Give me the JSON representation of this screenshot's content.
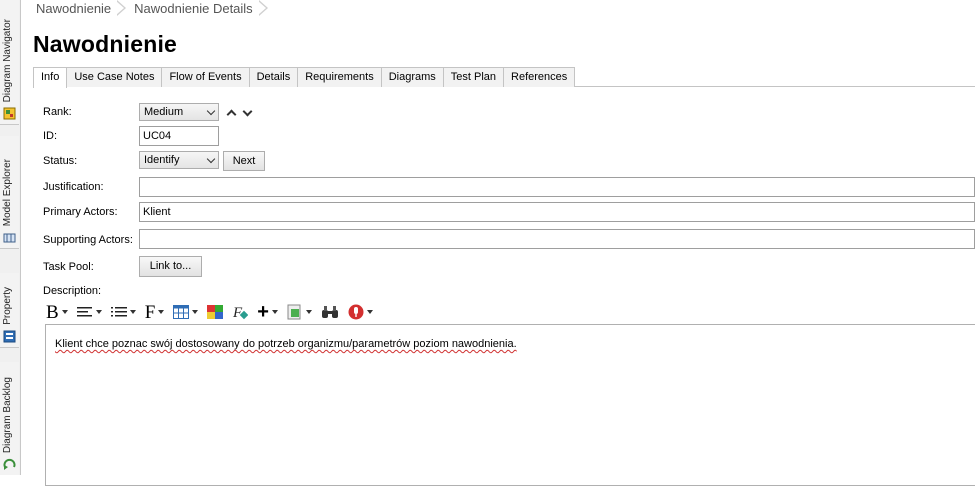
{
  "sidebar": {
    "items": [
      {
        "label": "Diagram Navigator",
        "icon": "diagram-navigator-icon"
      },
      {
        "label": "Model Explorer",
        "icon": "model-explorer-icon"
      },
      {
        "label": "Property",
        "icon": "property-icon"
      },
      {
        "label": "Diagram Backlog",
        "icon": "diagram-backlog-icon"
      }
    ]
  },
  "breadcrumb": [
    "Nawodnienie",
    "Nawodnienie Details"
  ],
  "title": "Nawodnienie",
  "tabs": [
    "Info",
    "Use Case Notes",
    "Flow of Events",
    "Details",
    "Requirements",
    "Diagrams",
    "Test Plan",
    "References"
  ],
  "active_tab": "Info",
  "form": {
    "rank_label": "Rank:",
    "rank_value": "Medium",
    "id_label": "ID:",
    "id_value": "UC04",
    "status_label": "Status:",
    "status_value": "Identify",
    "next_button": "Next",
    "justification_label": "Justification:",
    "justification_value": "",
    "primary_actors_label": "Primary Actors:",
    "primary_actors_value": "Klient",
    "supporting_actors_label": "Supporting Actors:",
    "supporting_actors_value": "",
    "task_pool_label": "Task Pool:",
    "link_button": "Link to...",
    "description_label": "Description:"
  },
  "description_text": "Klient chce poznac swój dostosowany do potrzeb organizmu/parametrów poziom nawodnienia.",
  "toolbar": {
    "bold_glyph": "B",
    "font_glyph": "F",
    "plus_glyph": "+"
  }
}
